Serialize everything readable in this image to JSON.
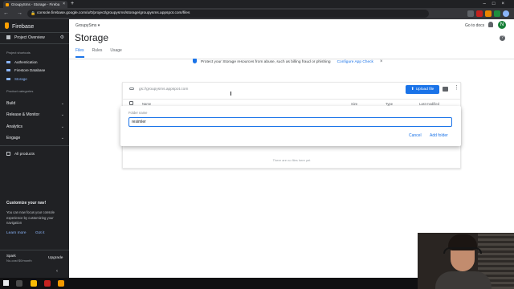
{
  "browser": {
    "tab_title": "GroupySms - Storage - Fireba",
    "tab_close": "×",
    "new_tab": "+",
    "window_controls": "–□×",
    "nav": "← → C",
    "url": "console.firebase.google.com/u/0/project/groupysms/storage/groupysms.appspot.com/files"
  },
  "sidebar": {
    "brand": "Firebase",
    "project_overview": "Project Overview",
    "shortcuts_caption": "Project shortcuts",
    "shortcuts": [
      {
        "label": "Authentication"
      },
      {
        "label": "Firestore Database"
      },
      {
        "label": "Storage"
      }
    ],
    "categories_caption": "Product categories",
    "sections": [
      {
        "label": "Build"
      },
      {
        "label": "Release & Monitor"
      },
      {
        "label": "Analytics"
      },
      {
        "label": "Engage"
      }
    ],
    "all_products": "All products",
    "customize": {
      "title": "Customize your nav!",
      "body": "You can now focus your console experience by customizing your navigation",
      "learn_more": "Learn more",
      "got_it": "Got it"
    },
    "plan": {
      "name": "Spark",
      "sub": "No-cost $0/month",
      "upgrade": "Upgrade"
    },
    "collapse": "‹"
  },
  "header": {
    "project": "GroupySms",
    "title": "Storage",
    "tabs": [
      {
        "label": "Files"
      },
      {
        "label": "Rules"
      },
      {
        "label": "Usage"
      }
    ],
    "go_to_docs": "Go to docs",
    "avatar_initial": "N",
    "help": "?"
  },
  "banner": {
    "text": "Protect your Storage resources from abuse, such as billing fraud or phishing",
    "action": "Configure App Check",
    "close": "×"
  },
  "storage": {
    "bucket": "gs://groupysms.appspot.com",
    "upload_label": "Upload file",
    "kebab": "⋮",
    "columns": {
      "name": "Name",
      "size": "Size",
      "type": "Type",
      "modified": "Last modified"
    },
    "empty": "There are no files here yet"
  },
  "dialog": {
    "label": "Folder name",
    "value": "resimler",
    "cancel": "Cancel",
    "add": "Add folder"
  },
  "colors": {
    "accent": "#1a73e8",
    "sidebar_bg": "#202124",
    "firebase_flame": "#ffa000"
  }
}
